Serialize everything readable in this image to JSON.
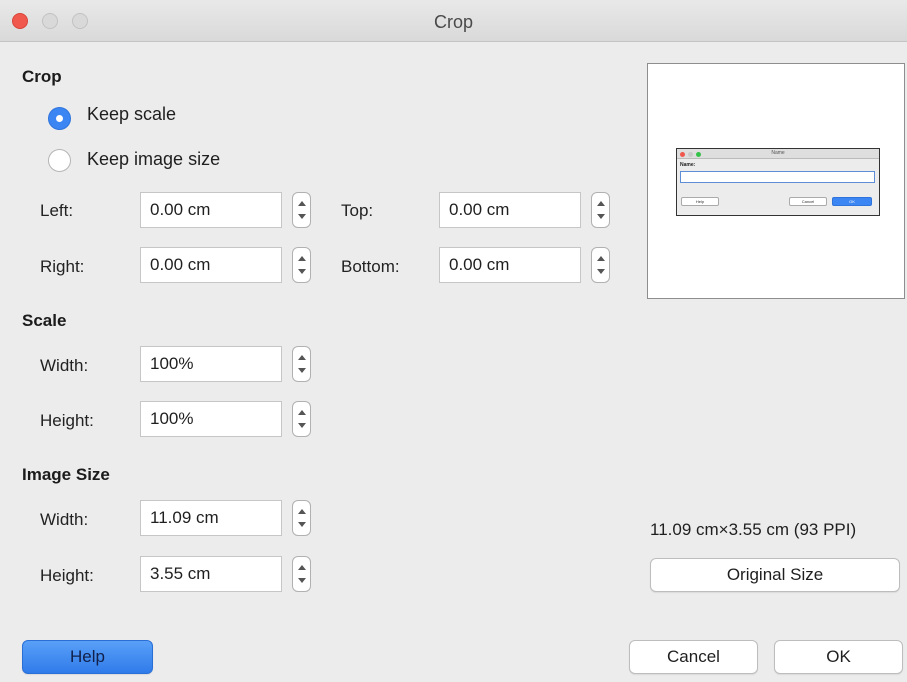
{
  "window": {
    "title": "Crop"
  },
  "crop": {
    "heading": "Crop",
    "keep_scale_label": "Keep scale",
    "keep_image_size_label": "Keep image size",
    "left_label": "Left:",
    "left_value": "0.00 cm",
    "right_label": "Right:",
    "right_value": "0.00 cm",
    "top_label": "Top:",
    "top_value": "0.00 cm",
    "bottom_label": "Bottom:",
    "bottom_value": "0.00 cm"
  },
  "scale": {
    "heading": "Scale",
    "width_label": "Width:",
    "width_value": "100%",
    "height_label": "Height:",
    "height_value": "100%"
  },
  "image_size": {
    "heading": "Image Size",
    "width_label": "Width:",
    "width_value": "11.09 cm",
    "height_label": "Height:",
    "height_value": "3.55 cm"
  },
  "preview": {
    "mini_title": "Name",
    "mini_label": "Name:",
    "mini_help": "Help",
    "mini_cancel": "Cancel",
    "mini_ok": "OK"
  },
  "info": {
    "original_dimensions": "11.09 cm×3.55 cm (93 PPI)"
  },
  "buttons": {
    "original_size": "Original Size",
    "help": "Help",
    "cancel": "Cancel",
    "ok": "OK"
  },
  "colors": {
    "accent": "#3b86f3",
    "close": "#f0574d"
  }
}
